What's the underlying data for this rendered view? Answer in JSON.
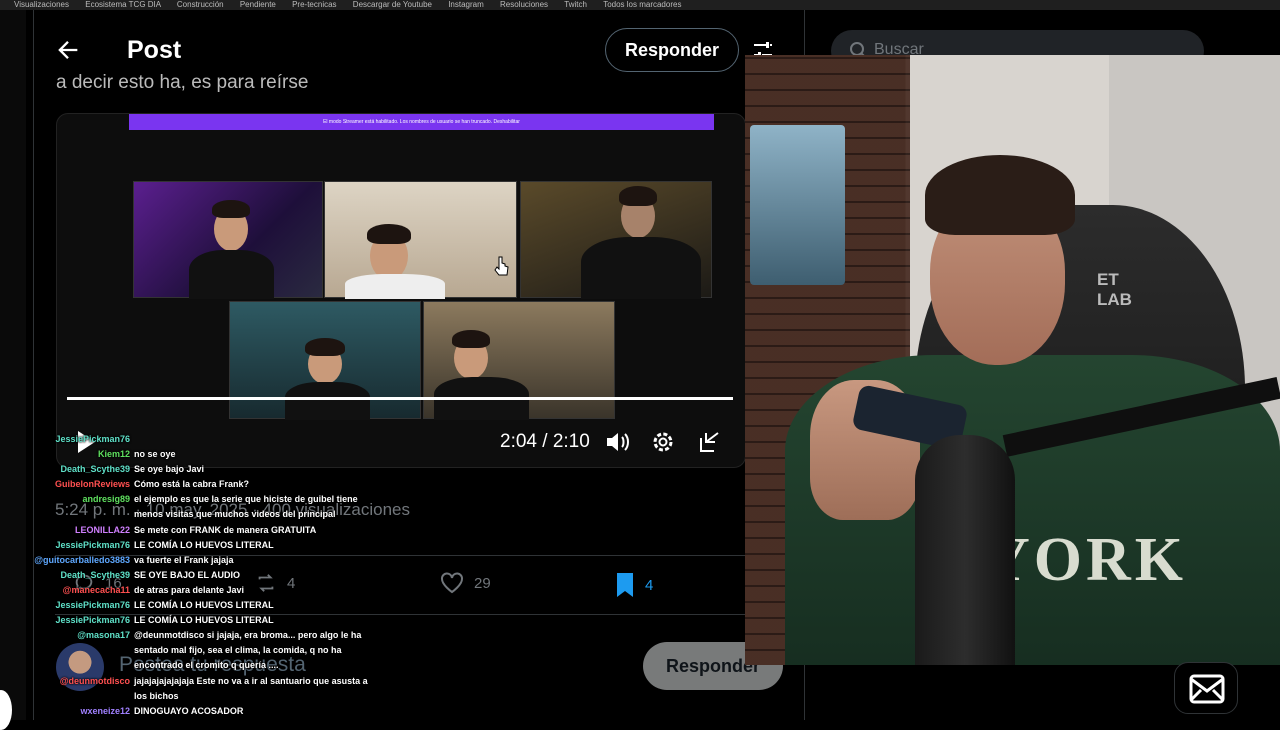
{
  "bookmarks_bar": {
    "items": [
      "Visualizaciones",
      "Ecosistema TCG DIA",
      "Construcción",
      "Pendiente",
      "Pre-tecnicas",
      "Descargar de Youtube",
      "Instagram",
      "Resoluciones",
      "Twitch",
      "Todos los marcadores"
    ]
  },
  "header": {
    "title": "Post",
    "reply_label": "Responder"
  },
  "post": {
    "text_fragment": "a decir esto ha, es para reírse",
    "meta": "5:24 p. m. · 10 may. 2025 · 400 visualizaciones"
  },
  "video": {
    "banner_text": "El modo Streamer está habilitado. Los nombres de usuario se han truncado.",
    "banner_button": "Deshabilitar",
    "time_display": "2:04 / 2:10",
    "progress": 0.98
  },
  "actions": {
    "replies": "16",
    "reposts": "4",
    "likes": "29",
    "bookmarks": "4"
  },
  "reply_box": {
    "placeholder": "Postea tu respuesta",
    "button": "Responder"
  },
  "search": {
    "placeholder": "Buscar"
  },
  "chat": {
    "messages": [
      {
        "user": "JessiePickman76",
        "text": "",
        "color": "#5fe0c8"
      },
      {
        "user": "Kiem12",
        "text": "no se oye",
        "color": "#5fe05f"
      },
      {
        "user": "Death_Scythe39",
        "text": "Se oye bajo Javi",
        "color": "#5fe0c8"
      },
      {
        "user": "GuibelonReviews",
        "text": "Cómo está la cabra Frank?",
        "color": "#ff5050"
      },
      {
        "user": "andresig89",
        "text": "el ejemplo es que la serie que hiciste de guibel tiene",
        "color": "#5fe05f"
      },
      {
        "user": "",
        "text": "menos visitas que muchos videos del principal",
        "color": "#fff"
      },
      {
        "user": "LEONILLA22",
        "text": "Se mete con FRANK de manera GRATUITA",
        "color": "#d080ff"
      },
      {
        "user": "JessiePickman76",
        "text": "LE COMÍA LO HUEVOS LITERAL",
        "color": "#5fe0c8"
      },
      {
        "user": "@guitocarballedo3883",
        "text": "va fuerte el Frank jajaja",
        "color": "#5fa8ff"
      },
      {
        "user": "Death_Scythe39",
        "text": "SE OYE BAJO EL AUDIO",
        "color": "#5fe0c8"
      },
      {
        "user": "@manecacha11",
        "text": "de atras para delante Javi",
        "color": "#ff5050"
      },
      {
        "user": "JessiePickman76",
        "text": "LE COMÍA LO HUEVOS LITERAL",
        "color": "#5fe0c8"
      },
      {
        "user": "JessiePickman76",
        "text": "LE COMÍA LO HUEVOS LITERAL",
        "color": "#5fe0c8"
      },
      {
        "user": "@masona17",
        "text": "@deunmotdisco si jajaja, era broma... pero algo le ha",
        "color": "#5fe0c8"
      },
      {
        "user": "",
        "text": "sentado mal fijo, sea el clima, la comida, q no ha",
        "color": "#fff"
      },
      {
        "user": "",
        "text": "encontrado el cromito q quería ....",
        "color": "#fff"
      },
      {
        "user": "@deunmotdisco",
        "text": "jajajajajajajaja Este no va a ir al santuario que asusta a",
        "color": "#ff5050"
      },
      {
        "user": "",
        "text": "los bichos",
        "color": "#fff"
      },
      {
        "user": "wxeneize12",
        "text": "DINOGUAYO ACOSADOR",
        "color": "#a080ff"
      }
    ]
  },
  "webcam": {
    "chair_logo_line1": "ET",
    "chair_logo_line2": "LAB",
    "sweater_text": "YORK"
  },
  "colors": {
    "accent": "#1d9bf0",
    "twitch": "#7a35f0",
    "background": "#000000"
  }
}
